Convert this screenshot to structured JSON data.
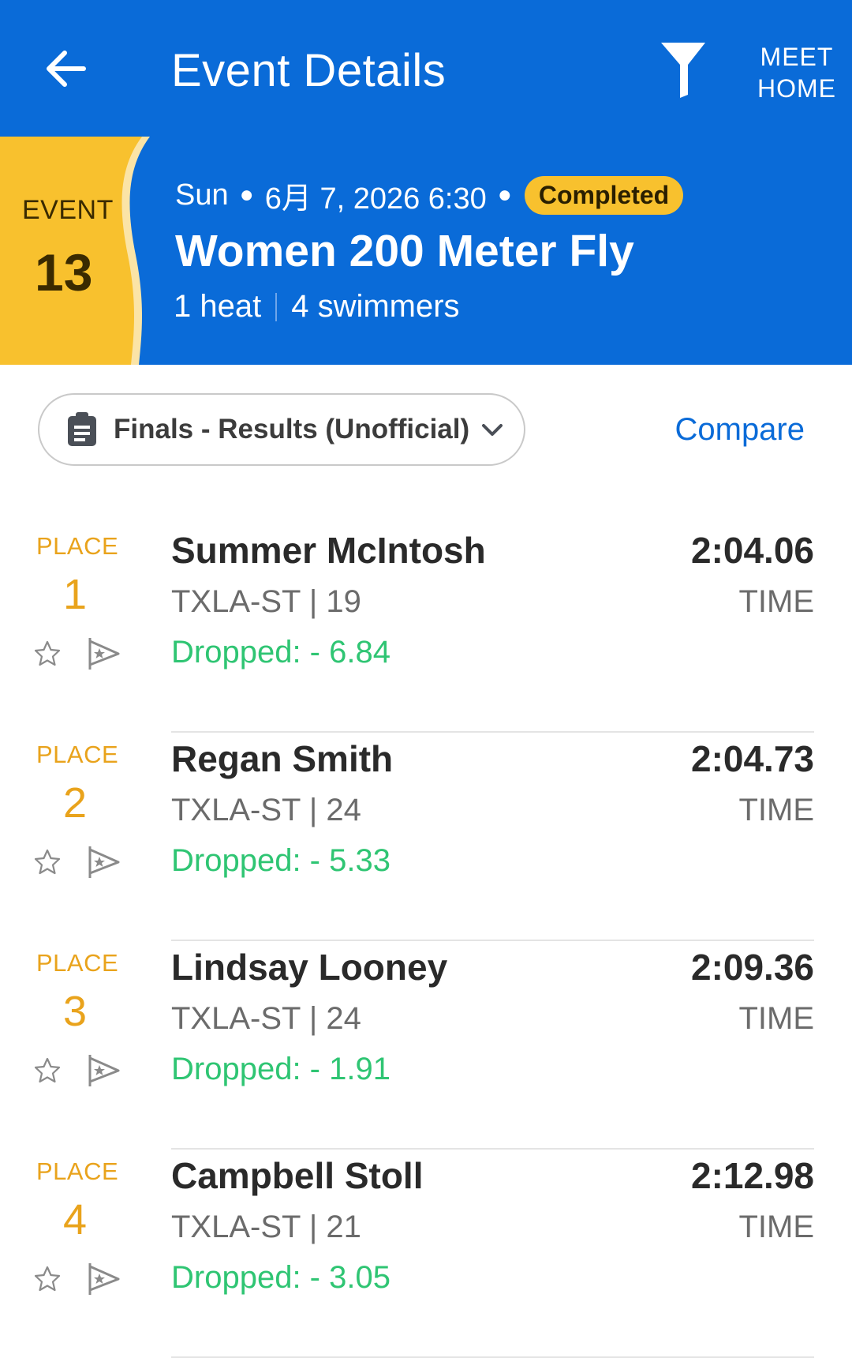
{
  "header": {
    "title": "Event Details",
    "meet_home": "MEET\nHOME",
    "back_icon": "arrow-left-icon",
    "filter_icon": "filter-icon"
  },
  "event": {
    "label": "EVENT",
    "number": "13",
    "day": "Sun",
    "datetime": "6月 7, 2026 6:30",
    "status": "Completed",
    "name": "Women 200 Meter Fly",
    "heats": "1 heat",
    "swimmers": "4 swimmers",
    "colors": {
      "header_blue": "#0a6bd8",
      "badge_yellow": "#f8c12e"
    }
  },
  "round": {
    "label": "Finals - Results (Unofficial)",
    "compare": "Compare"
  },
  "results": [
    {
      "place_label": "PLACE",
      "place": "1",
      "name": "Summer McIntosh",
      "team": "TXLA-ST | 19",
      "dropped": "Dropped: - 6.84",
      "time": "2:04.06",
      "time_label": "TIME"
    },
    {
      "place_label": "PLACE",
      "place": "2",
      "name": "Regan Smith",
      "team": "TXLA-ST | 24",
      "dropped": "Dropped: - 5.33",
      "time": "2:04.73",
      "time_label": "TIME"
    },
    {
      "place_label": "PLACE",
      "place": "3",
      "name": "Lindsay Looney",
      "team": "TXLA-ST | 24",
      "dropped": "Dropped: - 1.91",
      "time": "2:09.36",
      "time_label": "TIME"
    },
    {
      "place_label": "PLACE",
      "place": "4",
      "name": "Campbell Stoll",
      "team": "TXLA-ST | 21",
      "dropped": "Dropped: - 3.05",
      "time": "2:12.98",
      "time_label": "TIME"
    }
  ]
}
